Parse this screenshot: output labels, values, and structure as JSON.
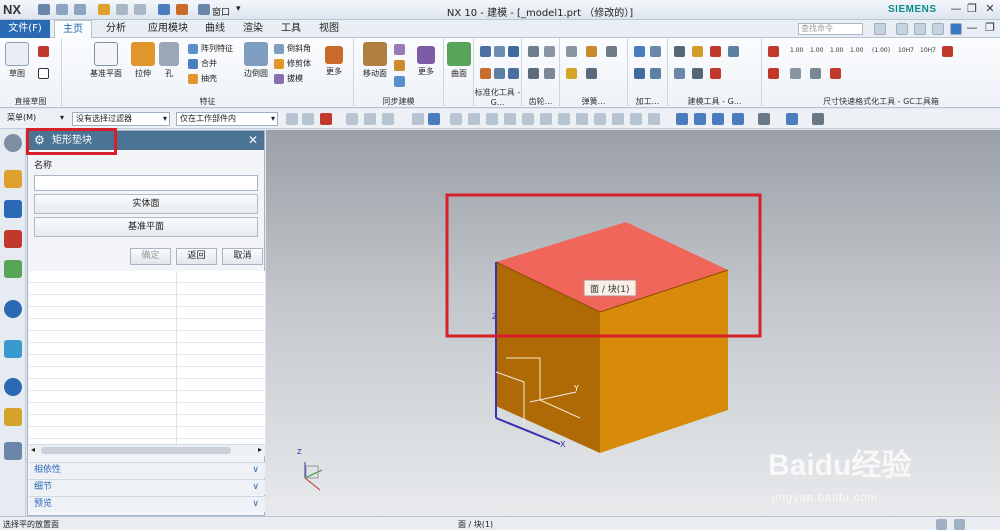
{
  "titlebar": {
    "logo": "NX",
    "window_menu": "窗口",
    "title": "NX 10 - 建模 - [_model1.prt （修改的）]",
    "brand": "SIEMENS"
  },
  "tabs": {
    "file": "文件(F)",
    "items": [
      "主页",
      "分析",
      "应用模块",
      "曲线",
      "渲染",
      "工具",
      "视图"
    ],
    "active": 0
  },
  "search": {
    "placeholder": "查找命令"
  },
  "ribbon": {
    "sketch_group": {
      "label": "直接草图",
      "sketch": "草图"
    },
    "feature_group": {
      "label": "特征",
      "datum_plane": "基准平面",
      "extrude": "拉伸",
      "hole": "孔",
      "pattern": "阵列特征",
      "unite": "合并",
      "shell": "抽壳",
      "edge_blend": "边倒圆",
      "chamfer": "倒斜角",
      "trim_body": "修剪体",
      "draft": "拔模",
      "more": "更多"
    },
    "sync_group": {
      "label": "同步建模",
      "move_face": "移动面",
      "more": "更多"
    },
    "surface": {
      "label": "曲面"
    },
    "labels": [
      "标准化工具 - G...",
      "齿轮...",
      "弹簧...",
      "加工...",
      "建模工具 - G...",
      "尺寸快速格式化工具 - GC工具箱"
    ],
    "dim_tags": [
      "1.00",
      "1.00",
      "1.00",
      "1.00",
      "(1.00)",
      "10H7",
      "10H7"
    ]
  },
  "selection_bar": {
    "menu": "菜单(M)",
    "filter": "没有选择过滤器",
    "scope": "仅在工作部件内"
  },
  "dialog": {
    "title": "矩形垫块",
    "name_label": "名称",
    "name_value": "",
    "solid_face": "实体面",
    "datum_plane": "基准平面",
    "ok": "确定",
    "back": "返回",
    "cancel": "取消",
    "sections": [
      "相依性",
      "细节",
      "预览"
    ]
  },
  "viewport": {
    "tooltip": "面 / 块(1)",
    "axis_x": "X",
    "axis_y": "Y",
    "axis_z": "Z"
  },
  "status": {
    "left": "选择平的放置面",
    "middle": "面 / 块(1)"
  },
  "watermark": {
    "text": "Baidu经验",
    "url": "jingyan.baidu.com"
  },
  "colors": {
    "accent": "#2a6ab4",
    "highlight": "#d8202a",
    "block_front": "#b06a05",
    "block_right": "#d88b0a",
    "block_top": "#f0665a"
  }
}
